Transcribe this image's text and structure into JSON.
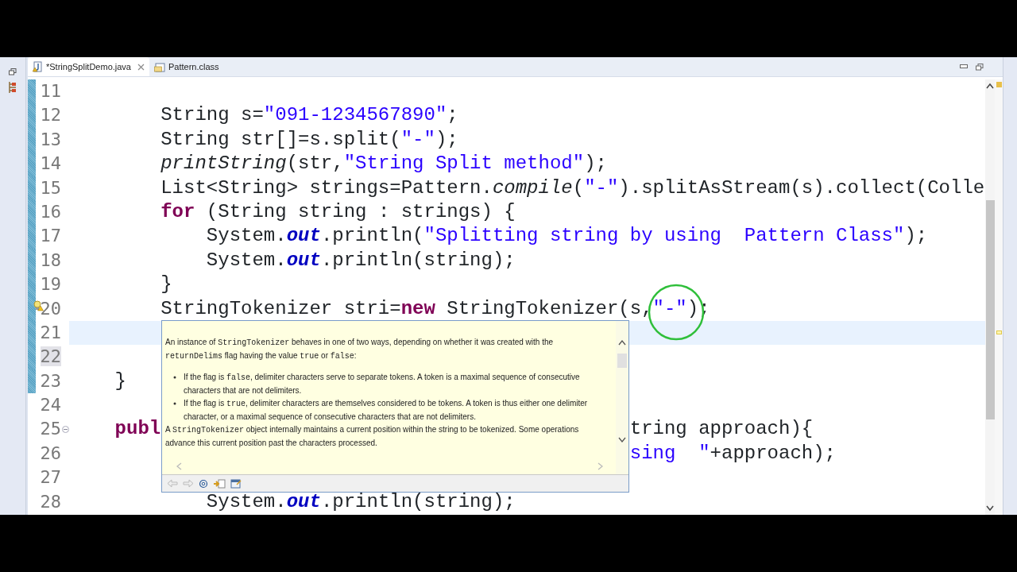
{
  "tabs": [
    {
      "label": "*StringSplitDemo.java",
      "kind": "java",
      "selected": true,
      "closable": true
    },
    {
      "label": "Pattern.class",
      "kind": "class",
      "selected": false,
      "closable": false
    }
  ],
  "editor": {
    "lines": [
      {
        "number": "11",
        "changed": true
      },
      {
        "number": "12",
        "changed": true,
        "segments": [
          {
            "text": "        String s=",
            "kind": "plain"
          },
          {
            "text": "\"091-1234567890\"",
            "kind": "string"
          },
          {
            "text": ";",
            "kind": "plain"
          }
        ]
      },
      {
        "number": "13",
        "changed": true,
        "segments": [
          {
            "text": "        String str[]=s.split(",
            "kind": "plain"
          },
          {
            "text": "\"-\"",
            "kind": "string"
          },
          {
            "text": ");",
            "kind": "plain"
          }
        ]
      },
      {
        "number": "14",
        "changed": true,
        "segments": [
          {
            "text": "        printString",
            "kind": "static-method"
          },
          {
            "text": "(str,",
            "kind": "plain"
          },
          {
            "text": "\"String Split method\"",
            "kind": "string"
          },
          {
            "text": ");",
            "kind": "plain"
          }
        ]
      },
      {
        "number": "15",
        "changed": true,
        "segments": [
          {
            "text": "        List<String> strings=Pattern.",
            "kind": "plain"
          },
          {
            "text": "compile",
            "kind": "static-method"
          },
          {
            "text": "(",
            "kind": "plain"
          },
          {
            "text": "\"-\"",
            "kind": "string"
          },
          {
            "text": ").splitAsStream(s).collect(Colle",
            "kind": "plain"
          }
        ]
      },
      {
        "number": "16",
        "changed": true,
        "segments": [
          {
            "text": "        for",
            "kind": "keyword"
          },
          {
            "text": " (String string : strings) {",
            "kind": "plain"
          }
        ]
      },
      {
        "number": "17",
        "changed": true,
        "segments": [
          {
            "text": "            System.",
            "kind": "plain"
          },
          {
            "text": "out",
            "kind": "static-field"
          },
          {
            "text": ".println(",
            "kind": "plain"
          },
          {
            "text": "\"Splitting string by using  Pattern Class\"",
            "kind": "string"
          },
          {
            "text": ");",
            "kind": "plain"
          }
        ]
      },
      {
        "number": "18",
        "changed": true,
        "segments": [
          {
            "text": "            System.",
            "kind": "plain"
          },
          {
            "text": "out",
            "kind": "static-field"
          },
          {
            "text": ".println(string);",
            "kind": "plain"
          }
        ]
      },
      {
        "number": "19",
        "changed": true,
        "segments": [
          {
            "text": "        }",
            "kind": "plain"
          }
        ]
      },
      {
        "number": "20",
        "changed": true,
        "quick_fix": true,
        "segments": [
          {
            "text": "        StringTokenizer stri=",
            "kind": "plain"
          },
          {
            "text": "new",
            "kind": "keyword"
          },
          {
            "text": " StringTokenizer(s,",
            "kind": "plain"
          },
          {
            "text": "\"-\"",
            "kind": "string"
          },
          {
            "text": ");",
            "kind": "plain"
          }
        ]
      },
      {
        "number": "21",
        "changed": true,
        "current": true
      },
      {
        "number": "22",
        "changed": true,
        "number_highlighted": true
      },
      {
        "number": "23",
        "changed": true,
        "segments": [
          {
            "text": "    }",
            "kind": "plain"
          }
        ]
      },
      {
        "number": "24"
      },
      {
        "number": "25",
        "foldable": true,
        "segments": [
          {
            "text": "    publ",
            "kind": "keyword"
          }
        ],
        "after_popup": [
          {
            "text": "tring approach){",
            "kind": "plain"
          }
        ]
      },
      {
        "number": "26",
        "after_popup": [
          {
            "text": "sing  \"",
            "kind": "string"
          },
          {
            "text": "+approach);",
            "kind": "plain"
          }
        ]
      },
      {
        "number": "27"
      },
      {
        "number": "28",
        "segments": [
          {
            "text": "            System.",
            "kind": "plain"
          },
          {
            "text": "out",
            "kind": "static-field"
          },
          {
            "text": ".println(string);",
            "kind": "plain"
          }
        ]
      }
    ]
  },
  "hover": {
    "paragraphs": [
      {
        "kind": "text",
        "segments": [
          {
            "text": "An instance of ",
            "kind": "text"
          },
          {
            "text": "StringTokenizer",
            "kind": "code"
          },
          {
            "text": " behaves in one of two ways, depending on whether it was created with the ",
            "kind": "text"
          },
          {
            "text": "returnDelims",
            "kind": "code"
          },
          {
            "text": " flag having the value ",
            "kind": "text"
          },
          {
            "text": "true",
            "kind": "code"
          },
          {
            "text": " or ",
            "kind": "text"
          },
          {
            "text": "false",
            "kind": "code"
          },
          {
            "text": ":",
            "kind": "text"
          }
        ]
      },
      {
        "kind": "bullet",
        "segments": [
          {
            "text": "If the flag is ",
            "kind": "text"
          },
          {
            "text": "false",
            "kind": "code"
          },
          {
            "text": ", delimiter characters serve to separate tokens. A token is a maximal sequence of consecutive characters that are not delimiters.",
            "kind": "text"
          }
        ]
      },
      {
        "kind": "bullet",
        "segments": [
          {
            "text": "If the flag is ",
            "kind": "text"
          },
          {
            "text": "true",
            "kind": "code"
          },
          {
            "text": ", delimiter characters are themselves considered to be tokens. A token is thus either one delimiter character, or a maximal sequence of consecutive characters that are not delimiters.",
            "kind": "text"
          }
        ]
      },
      {
        "kind": "text",
        "segments": [
          {
            "text": "A ",
            "kind": "text"
          },
          {
            "text": "StringTokenizer",
            "kind": "code"
          },
          {
            "text": " object internally maintains a current position within the string to be tokenized. Some operations advance this current position past the characters processed.",
            "kind": "text"
          }
        ]
      }
    ]
  }
}
